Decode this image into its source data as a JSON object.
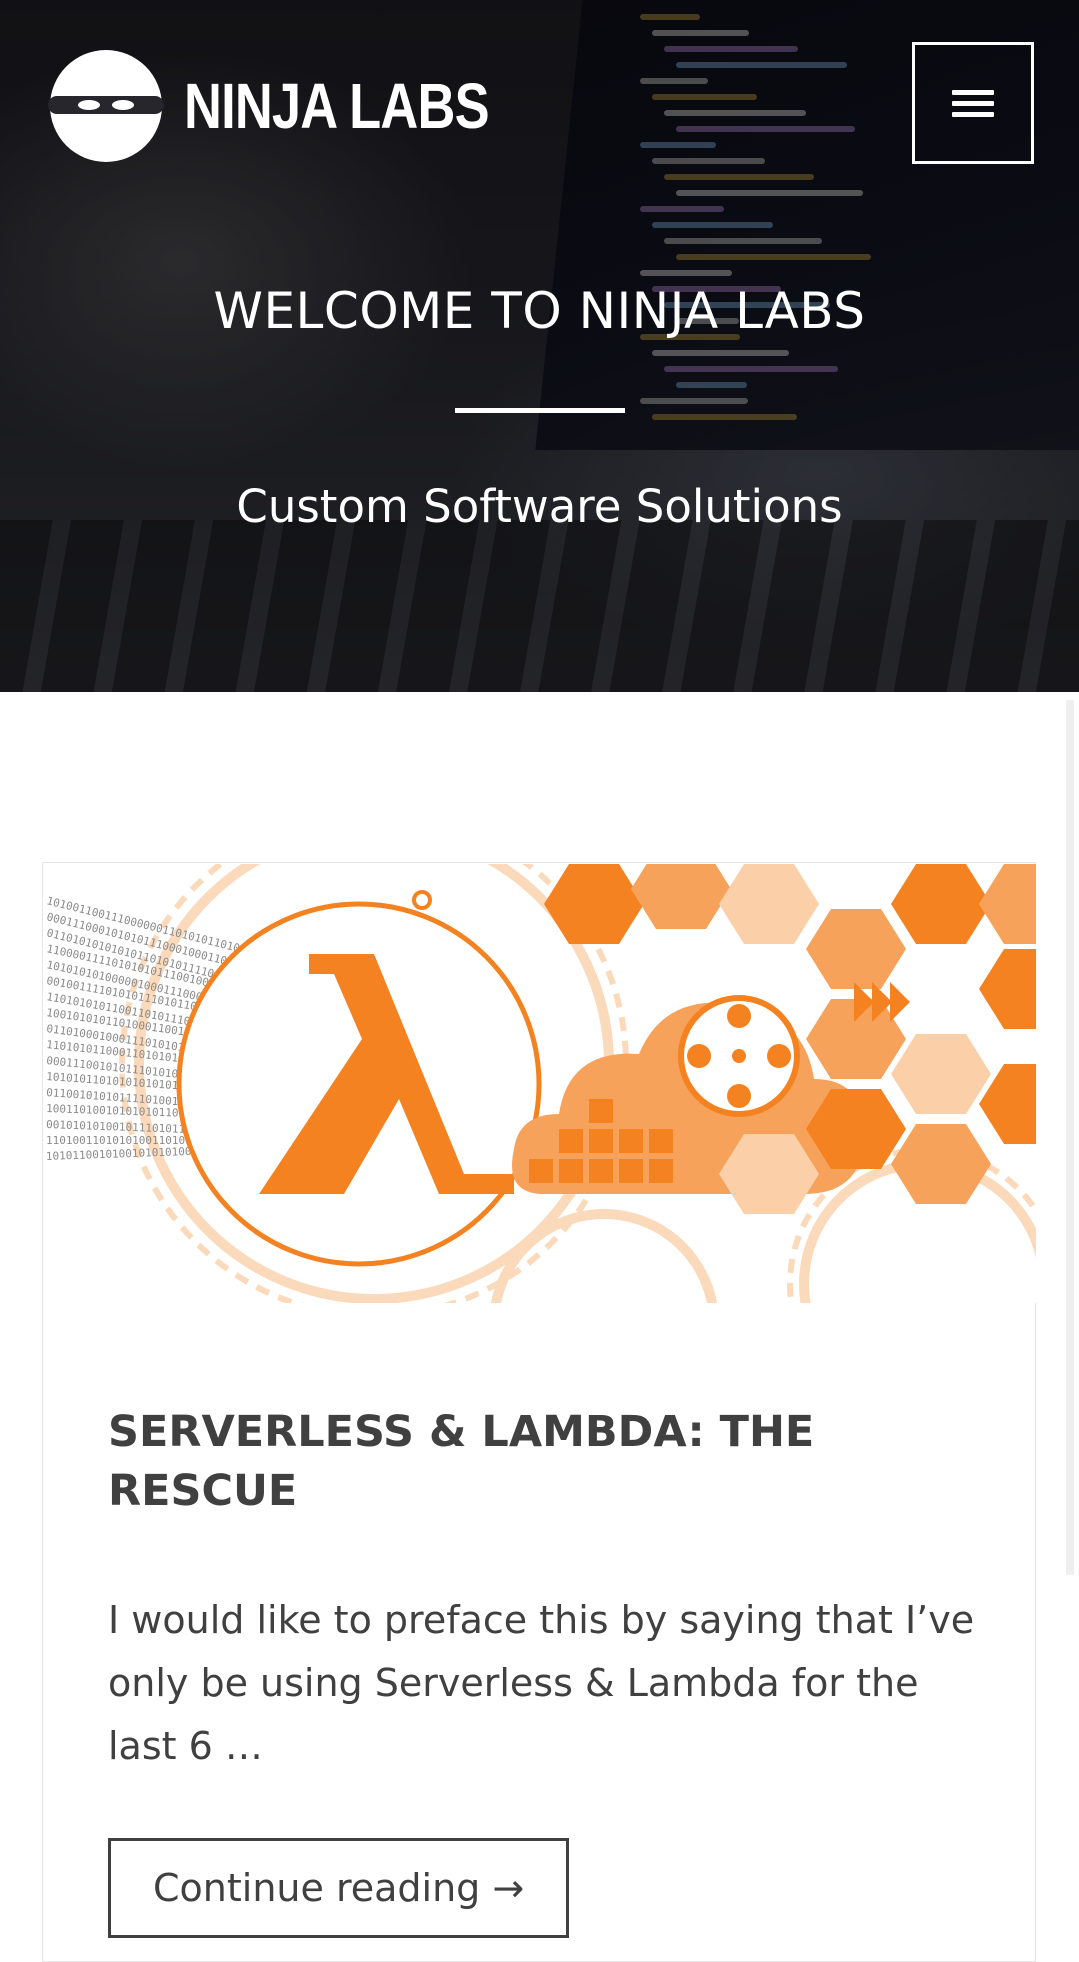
{
  "site": {
    "logo_text": "NINJA LABS",
    "menu_icon": "hamburger-menu-icon"
  },
  "hero": {
    "title": "WELCOME TO NINJA LABS",
    "subtitle": "Custom Software Solutions"
  },
  "post": {
    "image_icon": "aws-lambda-illustration",
    "title": "SERVERLESS & LAMBDA: THE RESCUE",
    "excerpt": "I would like to preface this by saying that I’ve only be using Serverless & Lambda for the last 6 …",
    "read_more_label": "Continue reading →"
  },
  "colors": {
    "accent_orange": "#f58220",
    "text": "#404040",
    "white": "#ffffff"
  }
}
